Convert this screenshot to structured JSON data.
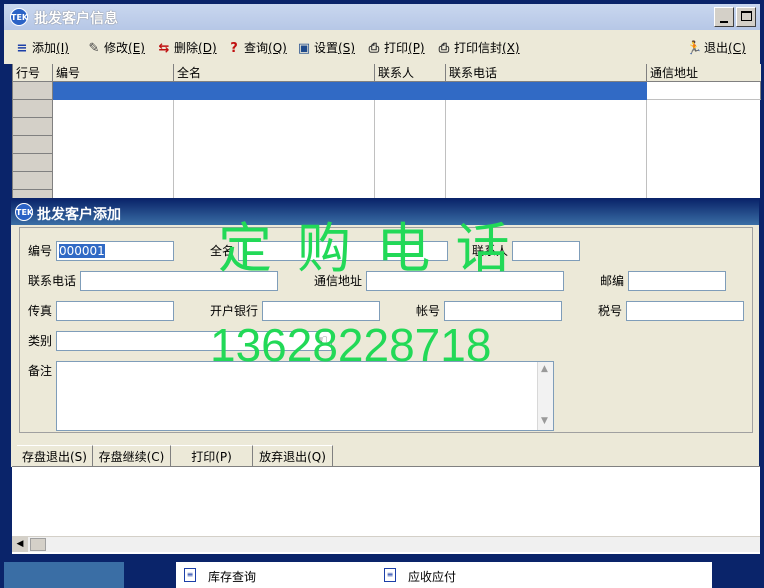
{
  "window": {
    "title": "批发客户信息",
    "icon_text": "TEK"
  },
  "toolbar": {
    "add": "添加",
    "add_key": "(I)",
    "edit": "修改",
    "edit_key": "(E)",
    "delete": "删除",
    "delete_key": "(D)",
    "query": "查询",
    "query_key": "(Q)",
    "settings": "设置",
    "settings_key": "(S)",
    "print": "打印",
    "print_key": "(P)",
    "print_env": "打印信封",
    "print_env_key": "(X)",
    "exit": "退出",
    "exit_key": "(C)"
  },
  "grid": {
    "columns": [
      "行号",
      "编号",
      "全名",
      "联系人",
      "联系电话",
      "通信地址"
    ]
  },
  "dialog": {
    "title": "批发客户添加",
    "icon_text": "TEK",
    "fields": {
      "code_label": "编号",
      "code_value": "000001",
      "fullname_label": "全名",
      "fullname_value": "",
      "contact_label": "联系人",
      "contact_value": "",
      "phone_label": "联系电话",
      "phone_value": "",
      "address_label": "通信地址",
      "address_value": "",
      "zip_label": "邮编",
      "zip_value": "",
      "fax_label": "传真",
      "fax_value": "",
      "bank_label": "开户银行",
      "bank_value": "",
      "account_label": "帐号",
      "account_value": "",
      "tax_label": "税号",
      "tax_value": "",
      "category_label": "类别",
      "category_value": "",
      "note_label": "备注",
      "note_value": ""
    },
    "buttons": {
      "save_exit": "存盘退出(S)",
      "save_continue": "存盘继续(C)",
      "print": "打印(P)",
      "discard_exit": "放弃退出(Q)"
    }
  },
  "watermark": {
    "line1": "定 购 电 话",
    "line2": "13628228718"
  },
  "bottom_panel": {
    "item1": "库存查询",
    "item2": "应收应付"
  },
  "colors": {
    "title_bar": "#0a246a",
    "selection": "#316ac5",
    "watermark": "#22d957"
  }
}
